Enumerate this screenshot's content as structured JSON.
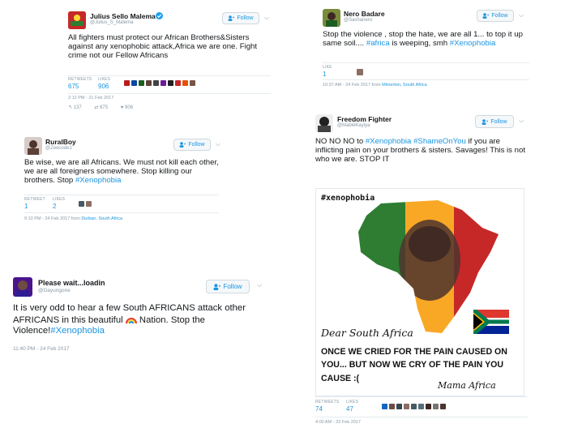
{
  "follow_label": "Follow",
  "tweets": {
    "malema": {
      "name": "Julius Sello Malema",
      "handle": "@Julius_S_Malema",
      "text": "All fighters must protect our African Brothers&Sisters against any xenophobic attack,Africa we are one. Fight crime not our Fellow Africans",
      "retweets_label": "RETWEETS",
      "retweets": "675",
      "likes_label": "LIKES",
      "likes": "906",
      "time": "2:12 PM - 21 Feb 2017",
      "action_replies": "137",
      "action_retweets": "675",
      "action_likes": "906"
    },
    "nero": {
      "name": "Nero Badare",
      "handle": "@Sashanero",
      "text_plain": "Stop the violence , stop the hate, we are all 1... to top it up same soil.... ",
      "hashtag1": "#africa",
      "text_mid": " is weeping, smh ",
      "hashtag2": "#Xenophobia",
      "likes_label": "LIKE",
      "likes": "1",
      "time": "10:37 AM - 24 Feb 2017 from ",
      "location": "Mimerton, South Africa"
    },
    "ruralboy": {
      "name": "RuralBoy",
      "handle": "@Zeecode1",
      "text_plain": "Be wise, we are all Africans. We must not kill each other, we are all foreigners somewhere. Stop killing our brothers. Stop ",
      "hashtag": "#Xenophobia",
      "retweets_label": "RETWEET",
      "retweets": "1",
      "likes_label": "LIKES",
      "likes": "2",
      "time": "9:10 PM - 24 Feb 2017 from ",
      "location": "Durban, South Africa"
    },
    "freedom": {
      "name": "Freedom Fighter",
      "handle": "@MableKayiya",
      "text_plain": "NO NO NO to ",
      "hashtag1": "#Xenophobia",
      "hashtag2": "#ShameOnYou",
      "text_rest": " if you are inflicting pain on your brothers & sisters. Savages! This is not who we are. STOP IT",
      "image_tag": "#xenophobia",
      "image_script": "Dear South Africa",
      "image_caption": "ONCE WE CRIED FOR THE PAIN CAUSED ON YOU... BUT NOW WE CRY OF THE PAIN YOU CAUSE :(",
      "image_signature": "Mama Africa",
      "retweets_label": "RETWEETS",
      "retweets": "74",
      "likes_label": "LIKES",
      "likes": "47",
      "time": "4:00 AM - 23 Feb 2017"
    },
    "please": {
      "name": "Please wait...loadin",
      "handle": "@Dayungone",
      "text_plain": "It is very odd to hear a few South AFRICANS attack other AFRICANS in this beautiful ",
      "text_after_emoji": " Nation. Stop the Violence!",
      "hashtag": "#Xenophobia",
      "time": "11:40 PM - 24 Feb 2017"
    }
  },
  "colors": {
    "link": "#1b95e0",
    "verified": "#1da1f2",
    "muted": "#8899a6"
  },
  "icons": [
    "follow-person-icon",
    "verified-badge-icon",
    "chevron-down-icon",
    "reply-icon",
    "retweet-icon",
    "like-icon",
    "rainbow-emoji-icon",
    "south-africa-flag-icon",
    "africa-map-icon"
  ]
}
